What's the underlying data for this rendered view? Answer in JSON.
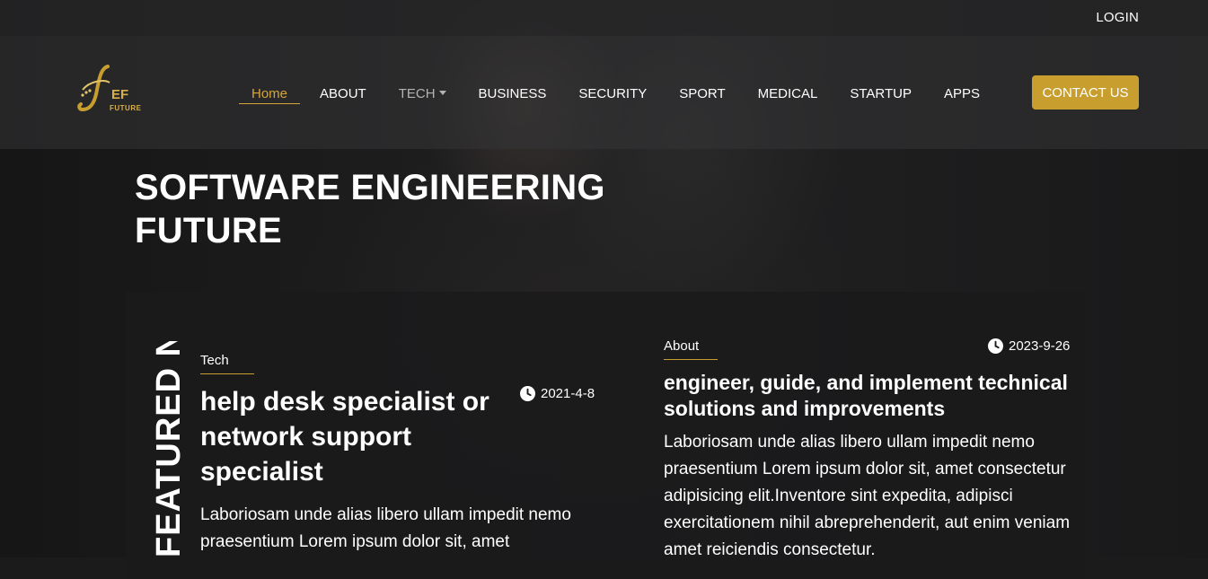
{
  "header": {
    "login_label": "LOGIN",
    "logo_text": "EF",
    "logo_subtext": "FUTURE",
    "contact_label": "CONTACT US"
  },
  "nav": {
    "items": [
      {
        "label": "Home",
        "state": "active"
      },
      {
        "label": "ABOUT"
      },
      {
        "label": "TECH",
        "has_dropdown": true
      },
      {
        "label": "BUSINESS"
      },
      {
        "label": "SECURITY"
      },
      {
        "label": "SPORT"
      },
      {
        "label": "MEDICAL"
      },
      {
        "label": "STARTUP"
      },
      {
        "label": "APPS"
      }
    ]
  },
  "hero": {
    "title_line1": "SOFTWARE ENGINEERING",
    "title_line2": "FUTURE"
  },
  "featured": {
    "section_label": "FEATURED NEWS",
    "articles": [
      {
        "category": "Tech",
        "date": "2021-4-8",
        "title": "help desk specialist or network support specialist",
        "excerpt": "Laboriosam unde alias libero ullam impedit nemo praesentium Lorem ipsum dolor sit, amet"
      },
      {
        "category": "About",
        "date": "2023-9-26",
        "title": "engineer, guide, and implement technical solutions and improvements",
        "excerpt": "Laboriosam unde alias libero ullam impedit nemo praesentium Lorem ipsum dolor sit, amet consectetur adipisicing elit.Inventore sint expedita, adipisci exercitationem nihil abreprehenderit, aut enim veniam amet reiciendis consectetur."
      }
    ]
  },
  "colors": {
    "accent": "#c89e2f",
    "active_nav": "#d4a63a",
    "background": "#1b1b1c"
  },
  "icons": {
    "date": "clock-icon",
    "dropdown": "caret-down-icon"
  }
}
